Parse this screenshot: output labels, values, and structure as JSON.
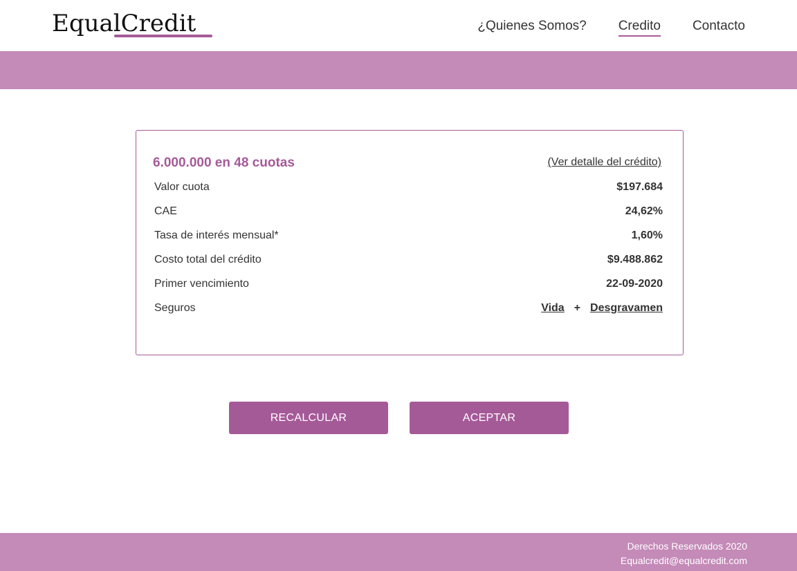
{
  "header": {
    "logo_text": "EqualCredit",
    "nav": [
      {
        "label": "¿Quienes Somos?",
        "active": false
      },
      {
        "label": "Credito",
        "active": true
      },
      {
        "label": "Contacto",
        "active": false
      }
    ]
  },
  "summary": {
    "title": "6.000.000 en 48 cuotas",
    "detail_link": "(Ver detalle del crédito)",
    "rows": [
      {
        "label": "Valor cuota",
        "value": "$197.684"
      },
      {
        "label": "CAE",
        "value": "24,62%"
      },
      {
        "label": "Tasa de interés mensual*",
        "value": "1,60%"
      },
      {
        "label": "Costo total del crédito",
        "value": "$9.488.862"
      },
      {
        "label": "Primer vencimiento",
        "value": "22-09-2020"
      }
    ],
    "seguros": {
      "label": "Seguros",
      "option_1": "Vida",
      "separator": "+",
      "option_2": "Desgravamen"
    }
  },
  "actions": {
    "recalcular": "RECALCULAR",
    "aceptar": "ACEPTAR"
  },
  "footer": {
    "rights": "Derechos Reservados 2020",
    "email": "Equalcredit@equalcredit.com"
  },
  "colors": {
    "accent": "#a55a98",
    "band": "#c48ab8"
  }
}
